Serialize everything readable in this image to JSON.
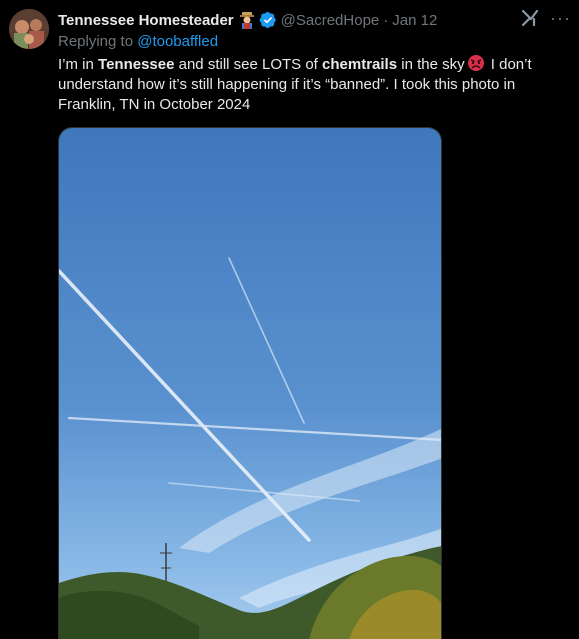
{
  "tweet": {
    "author_name": "Tennessee Homesteader",
    "author_handle": "@SacredHope",
    "separator": "·",
    "date": "Jan 12",
    "reply_prefix": "Replying to",
    "reply_to": "@toobaffled",
    "text_parts": [
      "I’m in ",
      "Tennessee",
      " and still see LOTS of ",
      "chemtrails",
      " in the sky",
      " I don’t understand how it’s still happening if it’s “banned”. I took this photo in Franklin, TN in October 2024"
    ],
    "more_label": "···"
  },
  "icons": {
    "verified": "verified-badge-icon",
    "emoji": "farmer-emoji-icon",
    "angry": "angry-face-emoji-icon",
    "grok": "grok-icon",
    "more": "more-icon"
  },
  "colors": {
    "background": "#000000",
    "text": "#e7e9ea",
    "muted": "#71767b",
    "link": "#1d9bf0",
    "verified": "#1d9bf0"
  }
}
